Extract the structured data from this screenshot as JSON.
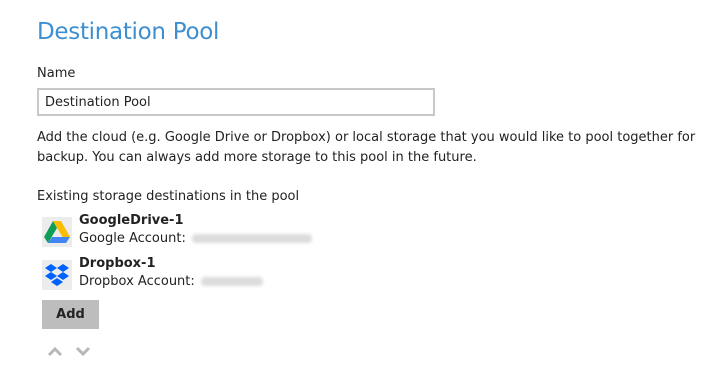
{
  "page": {
    "title": "Destination Pool",
    "name_label": "Name",
    "name_value": "Destination Pool",
    "description": "Add the cloud (e.g. Google Drive or Dropbox) or local storage that you would like to pool together for backup. You can always add more storage to this pool in the future.",
    "existing_label": "Existing storage destinations in the pool"
  },
  "destinations": [
    {
      "name": "GoogleDrive-1",
      "account_label": "Google Account:",
      "icon": "google-drive-icon"
    },
    {
      "name": "Dropbox-1",
      "account_label": "Dropbox Account:",
      "icon": "dropbox-icon"
    }
  ],
  "actions": {
    "add_label": "Add"
  },
  "icons": {
    "move_up": "chevron-up-icon",
    "move_down": "chevron-down-icon"
  },
  "colors": {
    "title": "#3d8fd1",
    "add_button": "#bdbdbd",
    "input_border": "#c8c8c8"
  }
}
